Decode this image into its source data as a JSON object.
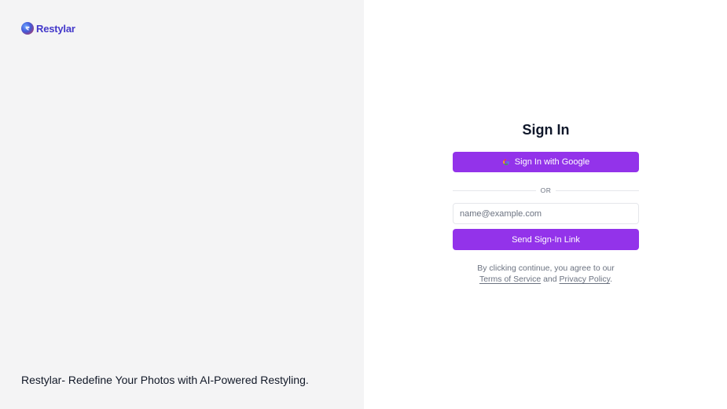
{
  "brand": {
    "name": "Restylar",
    "logo_icon": "restylar-logo-icon"
  },
  "tagline": "Restylar- Redefine Your Photos with AI-Powered Restyling.",
  "signin": {
    "title": "Sign In",
    "google_button_label": "Sign In with Google",
    "google_icon": "google-icon",
    "divider_text": "OR",
    "email_placeholder": "name@example.com",
    "email_value": "",
    "send_link_label": "Send Sign-In Link",
    "terms_prefix": "By clicking continue, you agree to our",
    "terms_link": "Terms of Service",
    "terms_and": "and",
    "privacy_link": "Privacy Policy",
    "terms_suffix": "."
  },
  "colors": {
    "accent": "#9333ea",
    "left_panel_bg": "#f4f4f5",
    "brand_text": "#4338ca",
    "muted_text": "#6b7280"
  }
}
